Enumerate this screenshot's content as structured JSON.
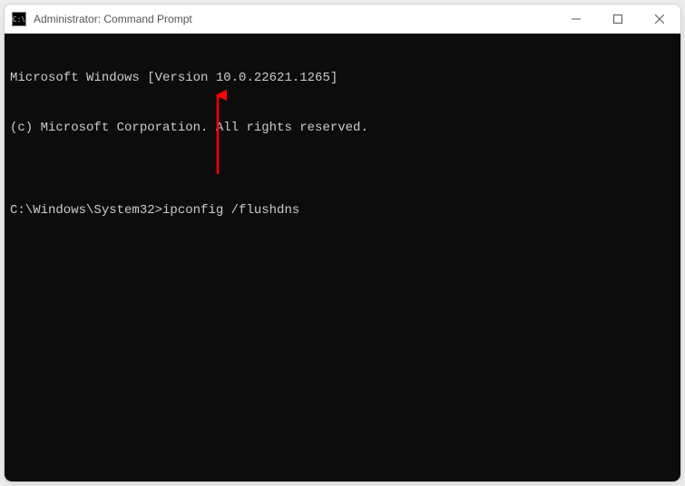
{
  "window": {
    "title": "Administrator: Command Prompt",
    "icon_label": "C:\\"
  },
  "terminal": {
    "line1": "Microsoft Windows [Version 10.0.22621.1265]",
    "line2": "(c) Microsoft Corporation. All rights reserved.",
    "blank": "",
    "prompt": "C:\\Windows\\System32>",
    "command": "ipconfig /flushdns"
  },
  "annotation": {
    "arrow_color": "#ff0000"
  }
}
